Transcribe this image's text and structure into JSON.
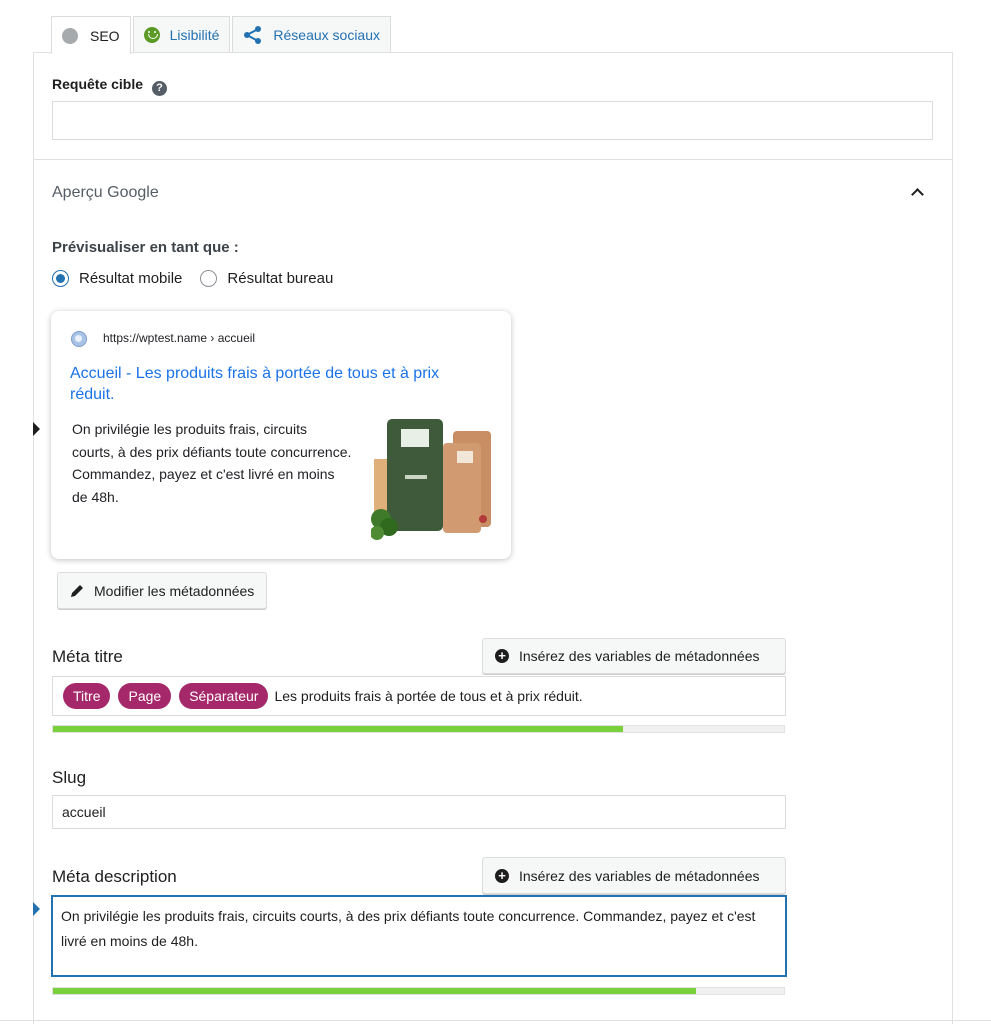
{
  "tabs": [
    {
      "label": "SEO",
      "icon": "grey-circle-icon"
    },
    {
      "label": "Lisibilité",
      "icon": "smiley-icon"
    },
    {
      "label": "Réseaux sociaux",
      "icon": "share-icon"
    }
  ],
  "focus_keyphrase": {
    "label": "Requête cible",
    "value": ""
  },
  "google_preview": {
    "title": "Aperçu Google",
    "preview_as_label": "Prévisualiser en tant que :",
    "options": [
      "Résultat mobile",
      "Résultat bureau"
    ],
    "selected": "Résultat mobile",
    "card": {
      "url": "https://wptest.name › accueil",
      "title": "Accueil - Les produits frais à portée de tous et à prix réduit.",
      "description": "On privilégie les produits frais, circuits courts, à des prix défiants toute concurrence. Commandez, payez et c'est livré en moins de 48h."
    },
    "edit_button": "Modifier les métadonnées"
  },
  "meta_title": {
    "label": "Méta titre",
    "insert_button": "Insérez des variables de métadonnées",
    "pills": [
      "Titre",
      "Page",
      "Séparateur"
    ],
    "text": "Les produits frais à portée de tous et à prix réduit.",
    "progress": 0.78
  },
  "slug": {
    "label": "Slug",
    "value": "accueil"
  },
  "meta_description": {
    "label": "Méta description",
    "insert_button": "Insérez des variables de métadonnées",
    "value": "On privilégie les produits frais, circuits courts, à des prix défiants toute concurrence. Commandez, payez et c'est livré en moins de 48h.",
    "progress": 0.88
  },
  "colors": {
    "accent": "#2271b1",
    "pill": "#a4286a",
    "progress_ok": "#7ad03a",
    "link": "#1a73e8"
  }
}
